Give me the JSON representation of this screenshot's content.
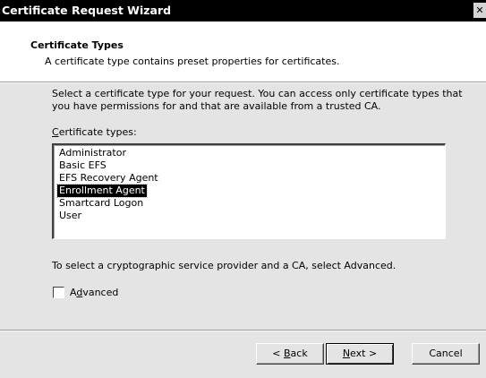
{
  "window": {
    "title": "Certificate Request Wizard",
    "close_glyph": "✕"
  },
  "header": {
    "title": "Certificate Types",
    "subtitle": "A certificate type contains preset properties for certificates."
  },
  "content": {
    "instructions_line1": "Select a certificate type for your request. You can access only certificate types that",
    "instructions_line2": "you have permissions for and that are available from a trusted CA.",
    "list_label_accel": "C",
    "list_label_rest": "ertificate types:",
    "certificate_types": [
      "Administrator",
      "Basic EFS",
      "EFS Recovery Agent",
      "Enrollment Agent",
      "Smartcard Logon",
      "User"
    ],
    "selected_index": 3,
    "advanced_hint": "To select a cryptographic service provider and a CA, select Advanced.",
    "advanced_checkbox": {
      "label_pre": "A",
      "label_accel": "d",
      "label_post": "vanced",
      "checked": false
    }
  },
  "buttons": {
    "back": {
      "pre": "< ",
      "accel": "B",
      "post": "ack"
    },
    "next": {
      "pre": "",
      "accel": "N",
      "post": "ext >"
    },
    "cancel": {
      "label": "Cancel"
    }
  },
  "colors": {
    "titlebar": "#000000",
    "dialog_face": "#e4e4e4",
    "selection": "#000000"
  }
}
